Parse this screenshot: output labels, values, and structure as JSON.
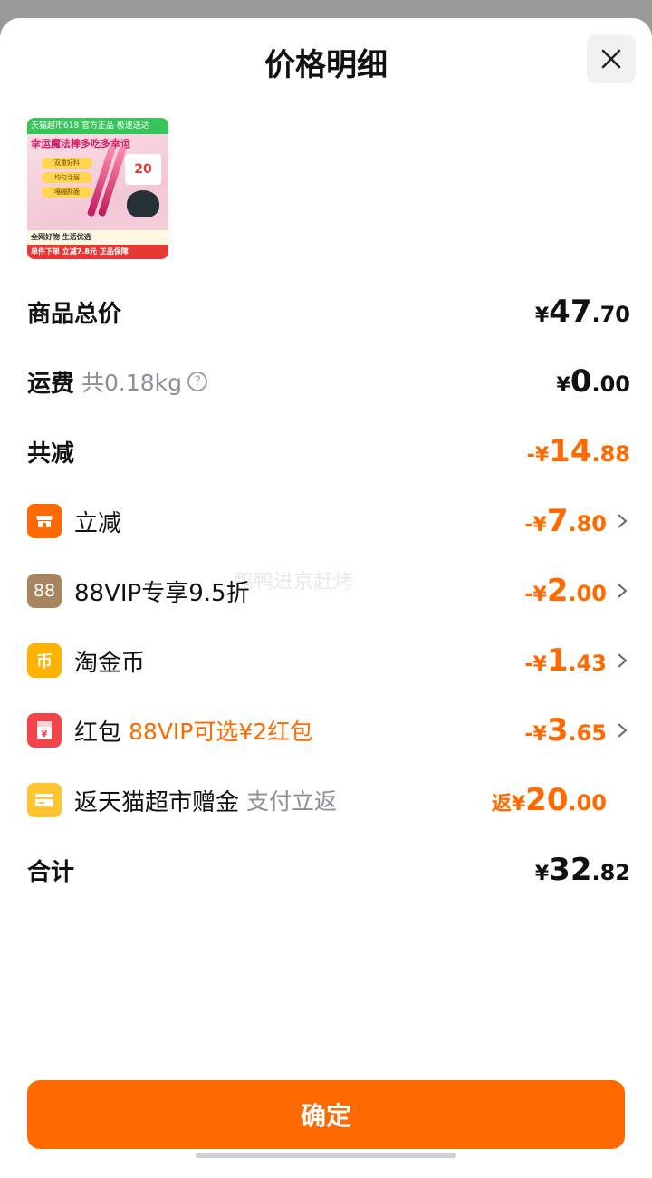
{
  "header": {
    "title": "价格明细"
  },
  "product_image": {
    "top_text": "天猫超市618 官方正品 极速送达",
    "banner": "幸运魔法棒多吃多幸运",
    "chips": [
      "双重好料",
      "均匀涂层",
      "嘎嘣酥脆"
    ],
    "card_value": "20",
    "bottom_line1": "全网好物 生活优选",
    "bottom_line2": "单件下单 立减7.8元 正品保障"
  },
  "rows": {
    "total": {
      "label": "商品总价",
      "currency": "¥",
      "int": "47",
      "dec": ".70"
    },
    "shipping": {
      "label": "运费",
      "sub": "共0.18kg",
      "help": "?",
      "currency": "¥",
      "int": "0",
      "dec": ".00"
    },
    "discount_total": {
      "label": "共减",
      "currency": "-¥",
      "int": "14",
      "dec": ".88"
    },
    "instant": {
      "icon_text": "",
      "label": "立减",
      "currency": "-¥",
      "int": "7",
      "dec": ".80"
    },
    "vip": {
      "icon_text": "88",
      "label": "88VIP专享9.5折",
      "currency": "-¥",
      "int": "2",
      "dec": ".00"
    },
    "coin": {
      "icon_text": "币",
      "label": "淘金币",
      "currency": "-¥",
      "int": "1",
      "dec": ".43"
    },
    "redpacket": {
      "icon_text": "¥",
      "label": "红包",
      "sub": "88VIP可选¥2红包",
      "currency": "-¥",
      "int": "3",
      "dec": ".65"
    },
    "cashback": {
      "label": "返天猫超市赠金",
      "sub": "支付立返",
      "currency": "返¥",
      "int": "20",
      "dec": ".00"
    },
    "sum": {
      "label": "合计",
      "currency": "¥",
      "int": "32",
      "dec": ".82"
    }
  },
  "watermark": "鸭鸭进京赶烤",
  "confirm_label": "确定",
  "colors": {
    "accent": "#ff6a00",
    "coin": "#ffb300",
    "red": "#f2434b",
    "vip": "#a8845f",
    "ticket": "#ffc531"
  }
}
